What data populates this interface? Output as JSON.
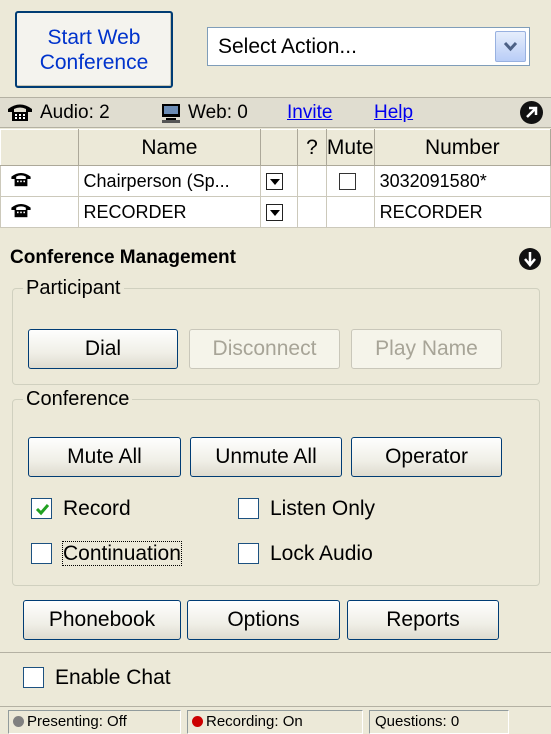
{
  "header": {
    "start_button_line1": "Start Web",
    "start_button_line2": "Conference",
    "action_select_value": "Select Action..."
  },
  "status": {
    "audio_label": "Audio: 2",
    "web_label": "Web: 0",
    "invite_link": "Invite",
    "help_link": "Help"
  },
  "participants": {
    "columns": [
      "",
      "Name",
      "",
      "?",
      "Mute",
      "Number"
    ],
    "rows": [
      {
        "name": "Chairperson (Sp...",
        "mute_checkbox": true,
        "number": "3032091580*"
      },
      {
        "name": "RECORDER",
        "mute_checkbox": false,
        "number": "RECORDER"
      }
    ]
  },
  "conference_management": {
    "title": "Conference Management",
    "participant_group": {
      "legend": "Participant",
      "dial": "Dial",
      "disconnect": "Disconnect",
      "play_name": "Play Name"
    },
    "conference_group": {
      "legend": "Conference",
      "mute_all": "Mute All",
      "unmute_all": "Unmute All",
      "operator": "Operator",
      "record": {
        "label": "Record",
        "checked": true
      },
      "listen_only": {
        "label": "Listen Only",
        "checked": false
      },
      "continuation": {
        "label": "Continuation",
        "checked": false
      },
      "lock_audio": {
        "label": "Lock Audio",
        "checked": false
      }
    }
  },
  "actions": {
    "phonebook": "Phonebook",
    "options": "Options",
    "reports": "Reports"
  },
  "chat": {
    "label": "Enable Chat",
    "checked": false
  },
  "footer": {
    "presenting": "Presenting: Off",
    "recording": "Recording: On",
    "questions": "Questions: 0"
  },
  "colors": {
    "link": "#0000ee",
    "start_button_text": "#0033cc",
    "recording_dot": "#cc0000",
    "presenting_dot": "#808080",
    "check_mark": "#21a121"
  }
}
